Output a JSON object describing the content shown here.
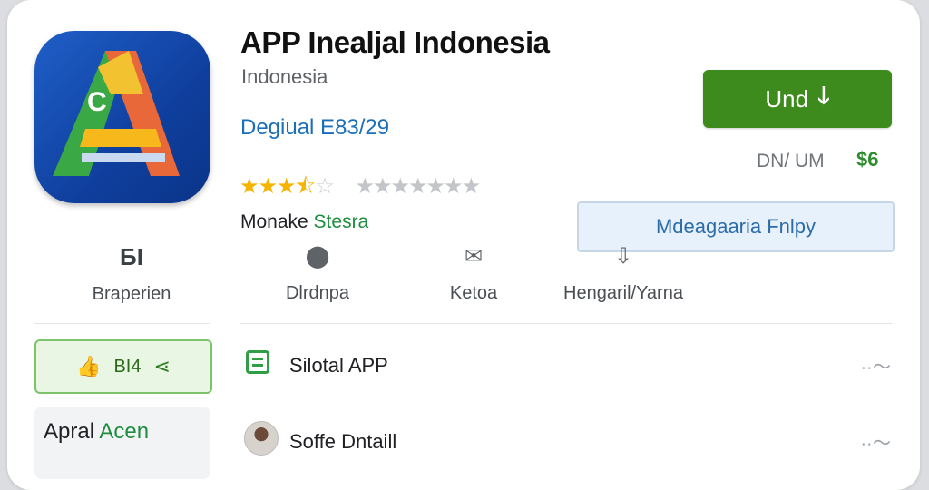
{
  "app": {
    "title": "APP Inealjal Indonesia",
    "subtitle": "Indonesia",
    "developer": "Degiual E83/29",
    "rating_stars": 3.5,
    "rating_max": 5,
    "maker_prefix": "Monake ",
    "maker_accent": "Stesra",
    "icon_letter": "C"
  },
  "actions": {
    "install_label": "Und",
    "size_text": "DN/ UM",
    "age_badge": "$6",
    "outline_label": "Mdeagaaria Fnlpy"
  },
  "stats": [
    {
      "value": "БI",
      "label": "Braperien",
      "icon": "count"
    },
    {
      "value": "",
      "label": "Dlrdnpa",
      "icon": "pin-icon"
    },
    {
      "value": "",
      "label": "Ketoa",
      "icon": "envelope-icon"
    },
    {
      "value": "",
      "label": "Hengaril/Yarna",
      "icon": "download-icon"
    }
  ],
  "sidebar": {
    "like_count": "BI4",
    "box_prefix": "Apral ",
    "box_accent": "Acen"
  },
  "rows": [
    {
      "label": "Silotal APP",
      "icon": "sheet-icon"
    },
    {
      "label": "Soffe Dntaill",
      "icon": "avatar"
    }
  ],
  "colors": {
    "install": "#3d8a1d",
    "link": "#1a6fb8",
    "accent_green": "#1e8e3e",
    "star": "#f4b400"
  }
}
